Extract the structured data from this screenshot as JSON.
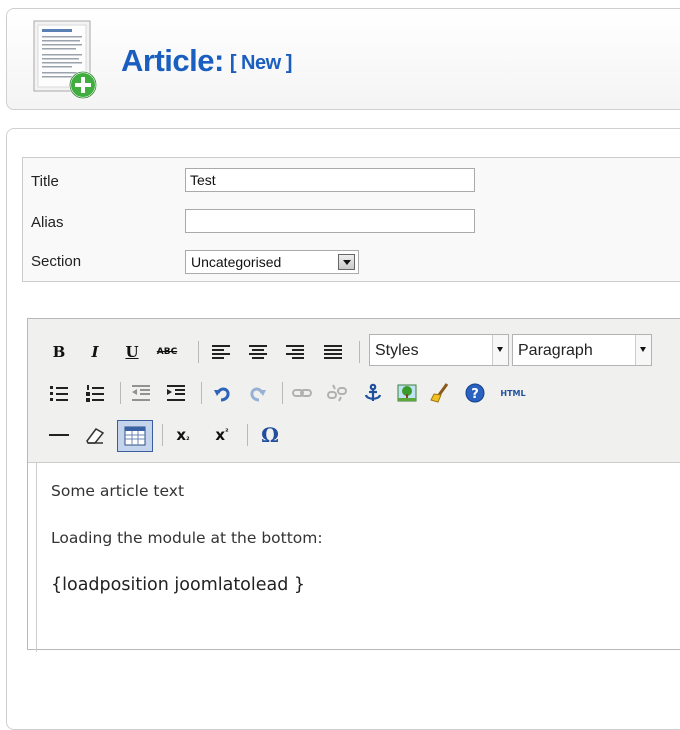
{
  "header": {
    "title": "Article:",
    "status": "[ New ]",
    "icon": "article-add-icon"
  },
  "form": {
    "title_label": "Title",
    "title_value": "Test",
    "alias_label": "Alias",
    "alias_value": "",
    "section_label": "Section",
    "section_value": "Uncategorised"
  },
  "toolbar": {
    "bold": "B",
    "italic": "I",
    "underline": "U",
    "strike": "ABC",
    "styles": "Styles",
    "format": "Paragraph",
    "html": "HTML",
    "icons_row1": [
      "bold-icon",
      "italic-icon",
      "underline-icon",
      "strikethrough-icon",
      "align-left-icon",
      "align-center-icon",
      "align-right-icon",
      "align-justify-icon"
    ],
    "icons_row2": [
      "bullet-list-icon",
      "numbered-list-icon",
      "outdent-icon",
      "indent-icon",
      "undo-icon",
      "redo-icon",
      "link-icon",
      "unlink-icon",
      "anchor-icon",
      "image-icon",
      "cleanup-icon",
      "help-icon",
      "html-source-icon"
    ],
    "icons_row3": [
      "horizontal-rule-icon",
      "remove-format-icon",
      "visual-aid-icon",
      "subscript-icon",
      "superscript-icon",
      "special-character-icon"
    ],
    "omega": "Ω",
    "accent": "#1f4f9e"
  },
  "content": {
    "line1": "Some article text",
    "line2": "Loading the module at the bottom:",
    "line3": "{loadposition joomlatolead }"
  }
}
